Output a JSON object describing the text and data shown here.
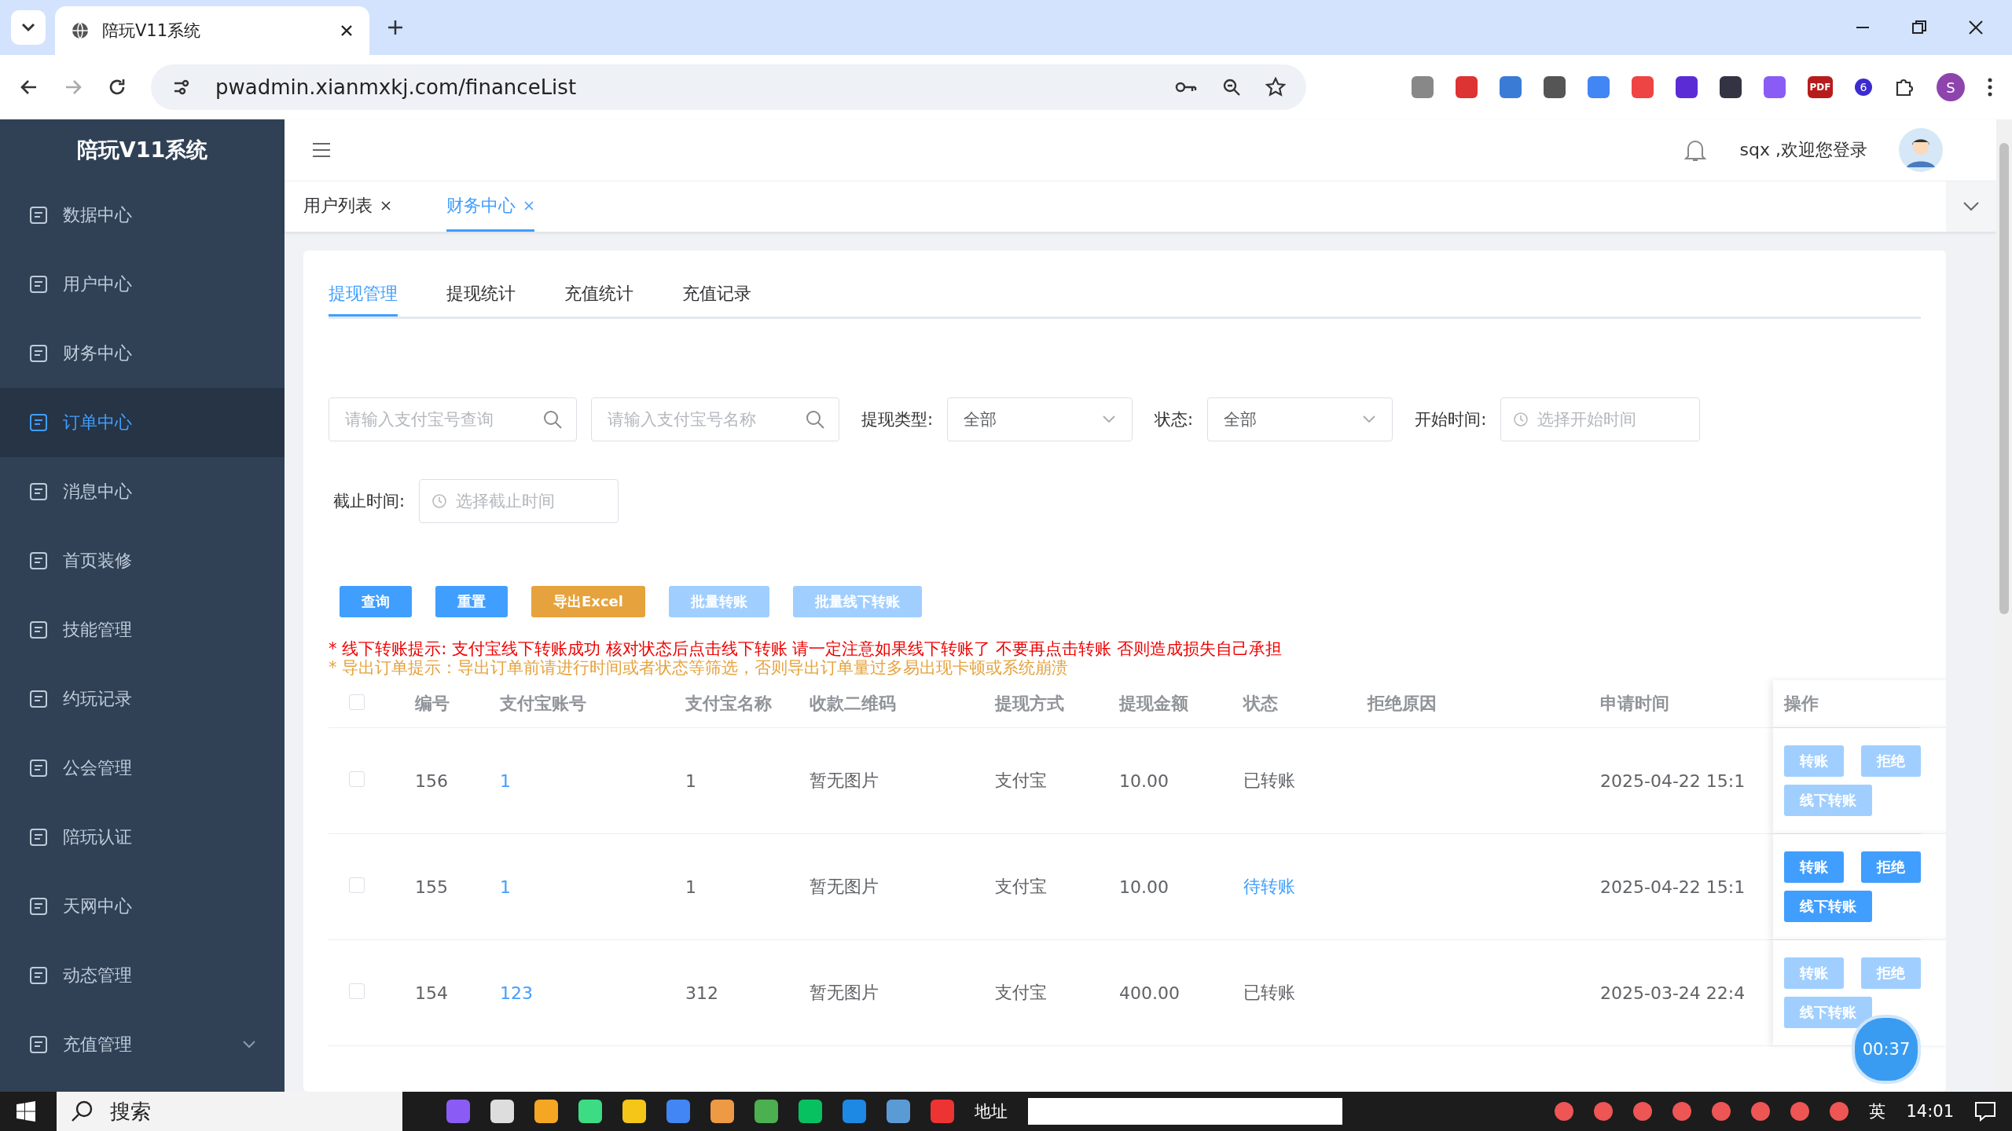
{
  "browser": {
    "tab_title": "陪玩V11系统",
    "url": "pwadmin.xianmxkj.com/financeList",
    "profile": "S",
    "extension_badge": "6",
    "pdf_label": "PDF"
  },
  "sidebar": {
    "title": "陪玩V11系统",
    "items": [
      {
        "label": "数据中心",
        "selected": false,
        "expandable": false
      },
      {
        "label": "用户中心",
        "selected": false,
        "expandable": false
      },
      {
        "label": "财务中心",
        "selected": false,
        "expandable": false
      },
      {
        "label": "订单中心",
        "selected": true,
        "expandable": false
      },
      {
        "label": "消息中心",
        "selected": false,
        "expandable": false
      },
      {
        "label": "首页装修",
        "selected": false,
        "expandable": false
      },
      {
        "label": "技能管理",
        "selected": false,
        "expandable": false
      },
      {
        "label": "约玩记录",
        "selected": false,
        "expandable": false
      },
      {
        "label": "公会管理",
        "selected": false,
        "expandable": false
      },
      {
        "label": "陪玩认证",
        "selected": false,
        "expandable": false
      },
      {
        "label": "天网中心",
        "selected": false,
        "expandable": false
      },
      {
        "label": "动态管理",
        "selected": false,
        "expandable": false
      },
      {
        "label": "充值管理",
        "selected": false,
        "expandable": true
      }
    ]
  },
  "header": {
    "greeting": "sqx ,欢迎您登录"
  },
  "page_tabs": [
    {
      "label": "用户列表",
      "selected": false
    },
    {
      "label": "财务中心",
      "selected": true
    }
  ],
  "sub_tabs": [
    {
      "label": "提现管理",
      "selected": true
    },
    {
      "label": "提现统计",
      "selected": false
    },
    {
      "label": "充值统计",
      "selected": false
    },
    {
      "label": "充值记录",
      "selected": false
    }
  ],
  "filters": {
    "search_fields": [
      {
        "placeholder": "请输入支付宝号查询"
      },
      {
        "placeholder": "请输入支付宝号名称"
      }
    ],
    "selects": [
      {
        "label": "提现类型:",
        "value": "全部"
      },
      {
        "label": "状态:",
        "value": "全部"
      }
    ],
    "dates": [
      {
        "label": "开始时间:",
        "placeholder": "选择开始时间"
      },
      {
        "label": "截止时间:",
        "placeholder": "选择截止时间"
      }
    ]
  },
  "buttons": [
    {
      "label": "查询",
      "kind": "primary"
    },
    {
      "label": "重置",
      "kind": "primary"
    },
    {
      "label": "导出Excel",
      "kind": "warning"
    },
    {
      "label": "批量转账",
      "kind": "light"
    },
    {
      "label": "批量线下转账",
      "kind": "light"
    }
  ],
  "notices": [
    {
      "text": "* 线下转账提示:  支付宝线下转账成功 核对状态后点击线下转账 请一定注意如果线下转账了 不要再点击转账 否则造成损失自己承担",
      "kind": "danger"
    },
    {
      "text": "* 导出订单提示：导出订单前请进行时间或者状态等筛选，否则导出订单量过多易出现卡顿或系统崩溃",
      "kind": "warning"
    }
  ],
  "table": {
    "select_all_checked": false,
    "columns": [
      "编号",
      "支付宝账号",
      "支付宝名称",
      "收款二维码",
      "提现方式",
      "提现金额",
      "状态",
      "拒绝原因",
      "申请时间",
      "操作"
    ],
    "rows": [
      {
        "checked": false,
        "id": "156",
        "account": "1",
        "name": "1",
        "qr": "暂无图片",
        "method": "支付宝",
        "amount": "10.00",
        "status": "已转账",
        "pending": false,
        "time": "2025-04-22 15:1",
        "actions": [
          "转账",
          "拒绝",
          "线下转账"
        ],
        "disabled": true
      },
      {
        "checked": false,
        "id": "155",
        "account": "1",
        "name": "1",
        "qr": "暂无图片",
        "method": "支付宝",
        "amount": "10.00",
        "status": "待转账",
        "pending": true,
        "time": "2025-04-22 15:1",
        "actions": [
          "转账",
          "拒绝",
          "线下转账"
        ],
        "disabled": false
      },
      {
        "checked": false,
        "id": "154",
        "account": "123",
        "name": "312",
        "qr": "暂无图片",
        "method": "支付宝",
        "amount": "400.00",
        "status": "已转账",
        "pending": false,
        "time": "2025-03-24 22:4",
        "actions": [
          "转账",
          "拒绝",
          "线下转账"
        ],
        "disabled": true
      }
    ]
  },
  "timer": "00:37",
  "taskbar": {
    "search": "搜索",
    "address_label": "地址",
    "ime": "英",
    "time": "14:01"
  }
}
